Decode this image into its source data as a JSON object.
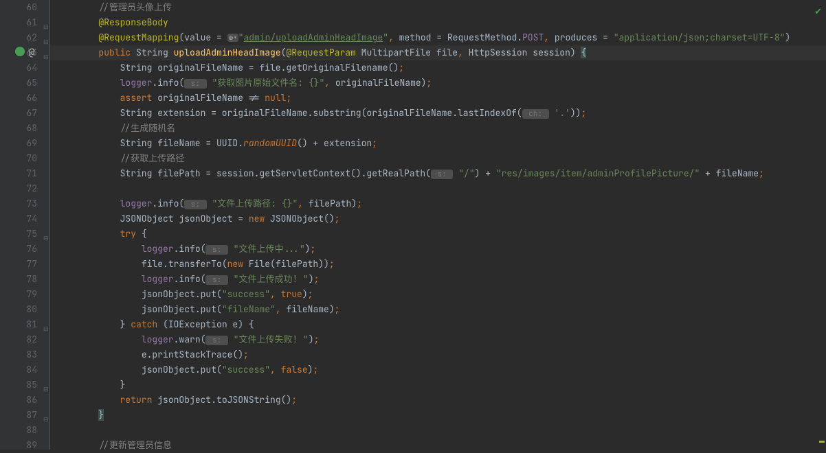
{
  "editor": {
    "startLine": 60,
    "lines": [
      {
        "num": 60,
        "indent": 8,
        "tokens": [
          {
            "t": "//管理员头像上传",
            "c": "c-comment"
          }
        ]
      },
      {
        "num": 61,
        "indent": 8,
        "tokens": [
          {
            "t": "@ResponseBody",
            "c": "c-annotation"
          }
        ]
      },
      {
        "num": 62,
        "indent": 8,
        "tokens": [
          {
            "t": "@RequestMapping",
            "c": "c-annotation"
          },
          {
            "t": "(value = "
          },
          {
            "t": "⊕▾",
            "c": "c-hint-icon"
          },
          {
            "t": "\"",
            "c": "c-string"
          },
          {
            "t": "admin/uploadAdminHeadImage",
            "c": "c-link"
          },
          {
            "t": "\"",
            "c": "c-string"
          },
          {
            "t": ",",
            "c": "c-comma"
          },
          {
            "t": " method = RequestMethod."
          },
          {
            "t": "POST",
            "c": "c-field"
          },
          {
            "t": ",",
            "c": "c-comma"
          },
          {
            "t": " produces = "
          },
          {
            "t": "\"application/json;charset=UTF-8\"",
            "c": "c-string"
          },
          {
            "t": ")"
          }
        ]
      },
      {
        "num": 63,
        "indent": 8,
        "current": true,
        "tokens": [
          {
            "t": "public ",
            "c": "c-keyword"
          },
          {
            "t": "String "
          },
          {
            "t": "uploadAdminHeadImage",
            "c": "c-method"
          },
          {
            "t": "("
          },
          {
            "t": "@RequestParam",
            "c": "c-annotation"
          },
          {
            "t": " MultipartFile file"
          },
          {
            "t": ",",
            "c": "c-comma"
          },
          {
            "t": " HttpSession session) "
          },
          {
            "t": "{",
            "c": "highlight-brace"
          }
        ]
      },
      {
        "num": 64,
        "indent": 12,
        "tokens": [
          {
            "t": "String originalFileName = file.getOriginalFilename()"
          },
          {
            "t": ";",
            "c": "c-semicolon"
          }
        ]
      },
      {
        "num": 65,
        "indent": 12,
        "tokens": [
          {
            "t": "logger",
            "c": "c-field"
          },
          {
            "t": ".info("
          },
          {
            "t": " s: ",
            "c": "c-hint"
          },
          {
            "t": " "
          },
          {
            "t": "\"获取图片原始文件名: {}\"",
            "c": "c-string"
          },
          {
            "t": ",",
            "c": "c-comma"
          },
          {
            "t": " originalFileName)"
          },
          {
            "t": ";",
            "c": "c-semicolon"
          }
        ]
      },
      {
        "num": 66,
        "indent": 12,
        "tokens": [
          {
            "t": "assert ",
            "c": "c-keyword"
          },
          {
            "t": "originalFileName != "
          },
          {
            "t": "null",
            "c": "c-null"
          },
          {
            "t": ";",
            "c": "c-semicolon"
          }
        ]
      },
      {
        "num": 67,
        "indent": 12,
        "tokens": [
          {
            "t": "String extension = originalFileName.substring(originalFileName.lastIndexOf("
          },
          {
            "t": " ch: ",
            "c": "c-hint"
          },
          {
            "t": " "
          },
          {
            "t": "'.'",
            "c": "c-string"
          },
          {
            "t": "))"
          },
          {
            "t": ";",
            "c": "c-semicolon"
          }
        ]
      },
      {
        "num": 68,
        "indent": 12,
        "tokens": [
          {
            "t": "//生成随机名",
            "c": "c-comment"
          }
        ]
      },
      {
        "num": 69,
        "indent": 12,
        "tokens": [
          {
            "t": "String fileName = UUID."
          },
          {
            "t": "randomUUID",
            "c": "c-static"
          },
          {
            "t": "() + extension"
          },
          {
            "t": ";",
            "c": "c-semicolon"
          }
        ]
      },
      {
        "num": 70,
        "indent": 12,
        "tokens": [
          {
            "t": "//获取上传路径",
            "c": "c-comment"
          }
        ]
      },
      {
        "num": 71,
        "indent": 12,
        "tokens": [
          {
            "t": "String filePath = session.getServletContext().getRealPath("
          },
          {
            "t": " s: ",
            "c": "c-hint"
          },
          {
            "t": " "
          },
          {
            "t": "\"/\"",
            "c": "c-string"
          },
          {
            "t": ") + "
          },
          {
            "t": "\"res/images/item/adminProfilePicture/\"",
            "c": "c-string"
          },
          {
            "t": " + fileName"
          },
          {
            "t": ";",
            "c": "c-semicolon"
          }
        ]
      },
      {
        "num": 72,
        "indent": 12,
        "tokens": []
      },
      {
        "num": 73,
        "indent": 12,
        "tokens": [
          {
            "t": "logger",
            "c": "c-field"
          },
          {
            "t": ".info("
          },
          {
            "t": " s: ",
            "c": "c-hint"
          },
          {
            "t": " "
          },
          {
            "t": "\"文件上传路径: {}\"",
            "c": "c-string"
          },
          {
            "t": ",",
            "c": "c-comma"
          },
          {
            "t": " filePath)"
          },
          {
            "t": ";",
            "c": "c-semicolon"
          }
        ]
      },
      {
        "num": 74,
        "indent": 12,
        "tokens": [
          {
            "t": "JSONObject jsonObject = "
          },
          {
            "t": "new ",
            "c": "c-keyword"
          },
          {
            "t": "JSONObject()"
          },
          {
            "t": ";",
            "c": "c-semicolon"
          }
        ]
      },
      {
        "num": 75,
        "indent": 12,
        "tokens": [
          {
            "t": "try ",
            "c": "c-keyword"
          },
          {
            "t": "{"
          }
        ]
      },
      {
        "num": 76,
        "indent": 16,
        "tokens": [
          {
            "t": "logger",
            "c": "c-field"
          },
          {
            "t": ".info("
          },
          {
            "t": " s: ",
            "c": "c-hint"
          },
          {
            "t": " "
          },
          {
            "t": "\"文件上传中...\"",
            "c": "c-string"
          },
          {
            "t": ")"
          },
          {
            "t": ";",
            "c": "c-semicolon"
          }
        ]
      },
      {
        "num": 77,
        "indent": 16,
        "tokens": [
          {
            "t": "file.transferTo("
          },
          {
            "t": "new ",
            "c": "c-keyword"
          },
          {
            "t": "File(filePath))"
          },
          {
            "t": ";",
            "c": "c-semicolon"
          }
        ]
      },
      {
        "num": 78,
        "indent": 16,
        "tokens": [
          {
            "t": "logger",
            "c": "c-field"
          },
          {
            "t": ".info("
          },
          {
            "t": " s: ",
            "c": "c-hint"
          },
          {
            "t": " "
          },
          {
            "t": "\"文件上传成功! \"",
            "c": "c-string"
          },
          {
            "t": ")"
          },
          {
            "t": ";",
            "c": "c-semicolon"
          }
        ]
      },
      {
        "num": 79,
        "indent": 16,
        "tokens": [
          {
            "t": "jsonObject.put("
          },
          {
            "t": "\"success\"",
            "c": "c-string"
          },
          {
            "t": ",",
            "c": "c-comma"
          },
          {
            "t": " "
          },
          {
            "t": "true",
            "c": "c-bool"
          },
          {
            "t": ")"
          },
          {
            "t": ";",
            "c": "c-semicolon"
          }
        ]
      },
      {
        "num": 80,
        "indent": 16,
        "tokens": [
          {
            "t": "jsonObject.put("
          },
          {
            "t": "\"fileName\"",
            "c": "c-string"
          },
          {
            "t": ",",
            "c": "c-comma"
          },
          {
            "t": " fileName)"
          },
          {
            "t": ";",
            "c": "c-semicolon"
          }
        ]
      },
      {
        "num": 81,
        "indent": 12,
        "tokens": [
          {
            "t": "} "
          },
          {
            "t": "catch ",
            "c": "c-keyword"
          },
          {
            "t": "(IOException e) {"
          }
        ]
      },
      {
        "num": 82,
        "indent": 16,
        "tokens": [
          {
            "t": "logger",
            "c": "c-field"
          },
          {
            "t": ".warn("
          },
          {
            "t": " s: ",
            "c": "c-hint"
          },
          {
            "t": " "
          },
          {
            "t": "\"文件上传失败! \"",
            "c": "c-string"
          },
          {
            "t": ")"
          },
          {
            "t": ";",
            "c": "c-semicolon"
          }
        ]
      },
      {
        "num": 83,
        "indent": 16,
        "tokens": [
          {
            "t": "e.printStackTrace()"
          },
          {
            "t": ";",
            "c": "c-semicolon"
          }
        ]
      },
      {
        "num": 84,
        "indent": 16,
        "tokens": [
          {
            "t": "jsonObject.put("
          },
          {
            "t": "\"success\"",
            "c": "c-string"
          },
          {
            "t": ",",
            "c": "c-comma"
          },
          {
            "t": " "
          },
          {
            "t": "false",
            "c": "c-bool"
          },
          {
            "t": ")"
          },
          {
            "t": ";",
            "c": "c-semicolon"
          }
        ]
      },
      {
        "num": 85,
        "indent": 12,
        "tokens": [
          {
            "t": "}"
          }
        ]
      },
      {
        "num": 86,
        "indent": 12,
        "tokens": [
          {
            "t": "return ",
            "c": "c-keyword"
          },
          {
            "t": "jsonObject.toJSONString()"
          },
          {
            "t": ";",
            "c": "c-semicolon"
          }
        ]
      },
      {
        "num": 87,
        "indent": 8,
        "tokens": [
          {
            "t": "}",
            "c": "highlight-brace"
          }
        ]
      },
      {
        "num": 88,
        "indent": 0,
        "tokens": []
      },
      {
        "num": 89,
        "indent": 8,
        "tokens": [
          {
            "t": "//更新管理员信息",
            "c": "c-comment"
          }
        ]
      }
    ]
  }
}
